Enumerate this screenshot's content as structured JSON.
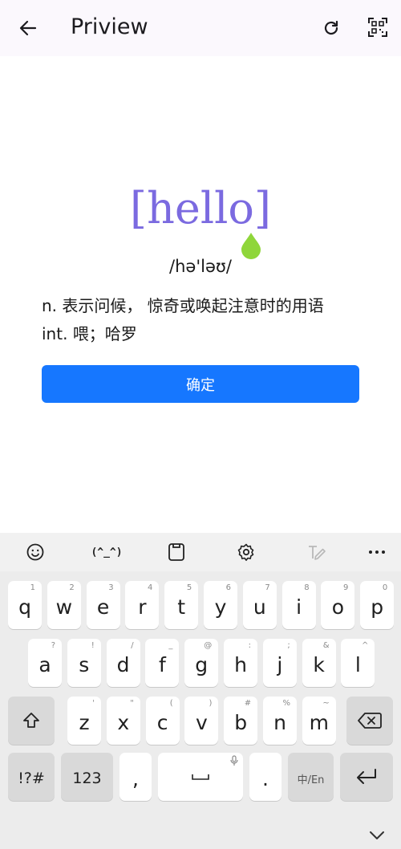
{
  "appbar": {
    "title": "Priview",
    "back_icon": "arrow-left-icon",
    "refresh_icon": "refresh-icon",
    "qr_icon": "qr-scan-icon"
  },
  "entry": {
    "word": "[hello]",
    "phonetic": "/hə'ləʊ/",
    "definitions": [
      "n. 表示问候， 惊奇或唤起注意时的用语",
      "int. 喂；哈罗"
    ],
    "confirm_label": "确定"
  },
  "keyboard": {
    "toolbar": {
      "emoji_icon": "emoji-icon",
      "kaomoji": "(^_^)",
      "clipboard_icon": "clipboard-icon",
      "settings_icon": "gear-icon",
      "handwriting_icon": "handwriting-icon",
      "more_icon": "more-icon"
    },
    "row1": [
      {
        "k": "q",
        "h": "1"
      },
      {
        "k": "w",
        "h": "2"
      },
      {
        "k": "e",
        "h": "3"
      },
      {
        "k": "r",
        "h": "4"
      },
      {
        "k": "t",
        "h": "5"
      },
      {
        "k": "y",
        "h": "6"
      },
      {
        "k": "u",
        "h": "7"
      },
      {
        "k": "i",
        "h": "8"
      },
      {
        "k": "o",
        "h": "9"
      },
      {
        "k": "p",
        "h": "0"
      }
    ],
    "row2": [
      {
        "k": "a",
        "h": "?"
      },
      {
        "k": "s",
        "h": "!"
      },
      {
        "k": "d",
        "h": "/"
      },
      {
        "k": "f",
        "h": "_"
      },
      {
        "k": "g",
        "h": "@"
      },
      {
        "k": "h",
        "h": ":"
      },
      {
        "k": "j",
        "h": ";"
      },
      {
        "k": "k",
        "h": "&"
      },
      {
        "k": "l",
        "h": "^"
      }
    ],
    "row3": [
      {
        "k": "z",
        "h": "'"
      },
      {
        "k": "x",
        "h": "\""
      },
      {
        "k": "c",
        "h": "("
      },
      {
        "k": "v",
        "h": ")"
      },
      {
        "k": "b",
        "h": "#"
      },
      {
        "k": "n",
        "h": "%"
      },
      {
        "k": "m",
        "h": "~"
      }
    ],
    "bottom": {
      "symbols": "!?#",
      "numbers": "123",
      "comma": ",",
      "period": ".",
      "lang": "中/En",
      "space_hint_icon": "microphone-icon"
    },
    "colors": {
      "accent": "#1677ff",
      "word": "#7b6ae0",
      "drop": "#8fd63a"
    }
  }
}
